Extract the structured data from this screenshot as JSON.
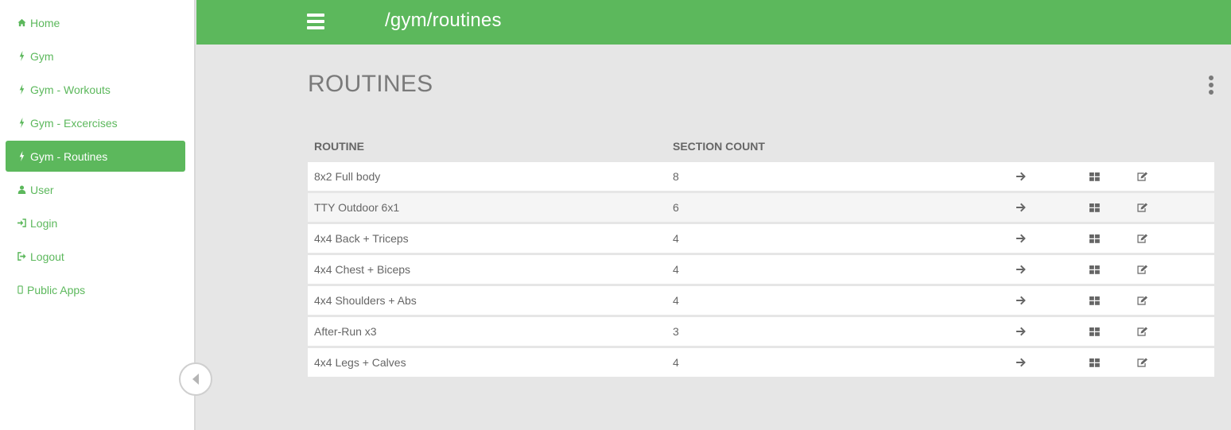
{
  "sidebar": {
    "items": [
      {
        "label": "Home",
        "icon": "home-icon",
        "active": false
      },
      {
        "label": "Gym",
        "icon": "bolt-icon",
        "active": false
      },
      {
        "label": "Gym - Workouts",
        "icon": "bolt-icon",
        "active": false
      },
      {
        "label": "Gym - Excercises",
        "icon": "bolt-icon",
        "active": false
      },
      {
        "label": "Gym - Routines",
        "icon": "bolt-icon",
        "active": true
      },
      {
        "label": "User",
        "icon": "user-icon",
        "active": false
      },
      {
        "label": "Login",
        "icon": "sign-in-icon",
        "active": false
      },
      {
        "label": "Logout",
        "icon": "sign-out-icon",
        "active": false
      },
      {
        "label": "Public Apps",
        "icon": "mobile-icon",
        "active": false
      }
    ]
  },
  "topbar": {
    "path": "/gym/routines"
  },
  "main": {
    "title": "ROUTINES",
    "table": {
      "headers": [
        "ROUTINE",
        "SECTION COUNT"
      ],
      "rows": [
        {
          "name": "8x2 Full body",
          "count": "8"
        },
        {
          "name": "TTY Outdoor 6x1",
          "count": "6"
        },
        {
          "name": "4x4 Back + Triceps",
          "count": "4"
        },
        {
          "name": "4x4 Chest + Biceps",
          "count": "4"
        },
        {
          "name": "4x4 Shoulders + Abs",
          "count": "4"
        },
        {
          "name": "After-Run x3",
          "count": "3"
        },
        {
          "name": "4x4 Legs + Calves",
          "count": "4"
        }
      ]
    }
  },
  "colors": {
    "accent": "#5cb85c",
    "text": "#666666",
    "title": "#7a7a7a",
    "background": "#e6e6e6"
  }
}
